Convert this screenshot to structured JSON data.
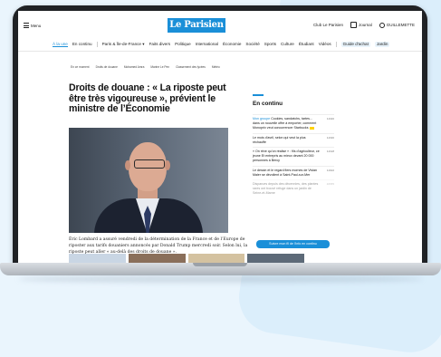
{
  "header": {
    "menu_label": "Menu",
    "logo_text": "Le Parisien",
    "club_label": "Club Le Parisien",
    "journal_label": "Journal",
    "user_label": "GUILLEMETTE"
  },
  "nav": {
    "items": [
      "À la une",
      "En continu",
      "Paris & Île-de-France ▾",
      "Faits divers",
      "Politique",
      "International",
      "Économie",
      "Société",
      "Sports",
      "Culture",
      "Étudiant",
      "Vidéos",
      "Guide d'achat",
      "Jardin"
    ]
  },
  "subnav": {
    "items": [
      "En ce moment",
      "Droits de douane",
      "Mohamed Amra",
      "Marine Le Pen",
      "Classement des lycées",
      "Météo"
    ]
  },
  "article": {
    "title": "Droits de douane : « La riposte peut être très vigoureuse », prévient le ministre de l’Économie",
    "caption": "Éric Lombard a assuré vendredi de la détermination de la France et de l’Europe de riposter aux tarifs douaniers annoncés par Donald Trump mercredi soir. Selon lui, la riposte peut aller « au-delà des droits de douane »."
  },
  "sidebar": {
    "title": "En continu",
    "items": [
      {
        "tag": "Mon groupe",
        "text": "Cookies, sandwichs, tartes… dans un nouvelle offre à emporter, comment Monoprix veut concurrencer Starbucks",
        "time": "11h40"
      },
      {
        "text": "Le mois d’avril, selon qui veut la plus réchauffé",
        "time": "11h30"
      },
      {
        "text": "« On rêve qu’on réalise » : fils d’agriculteur, ce jeune Et entrepris au mieux devant 20 000 personnes à Bercy",
        "time": "11h18"
      },
      {
        "text": "Le dessin et le regard fiers mornes de Vivian Maier se dévoilent à Saint-Paul-sur-Mer",
        "time": "11h02"
      },
      {
        "text": "Disparues depuis des décennies, des plantes rares ont trouvé refuge dans un jardin de Seine-et-Marne",
        "time": "10h55",
        "faded": true
      }
    ],
    "button_label": "Suivre mon fil de l'info en continu"
  },
  "colors": {
    "brand": "#1a8fd8",
    "background": "#eaf5fd",
    "highlight": "#ffd200"
  }
}
